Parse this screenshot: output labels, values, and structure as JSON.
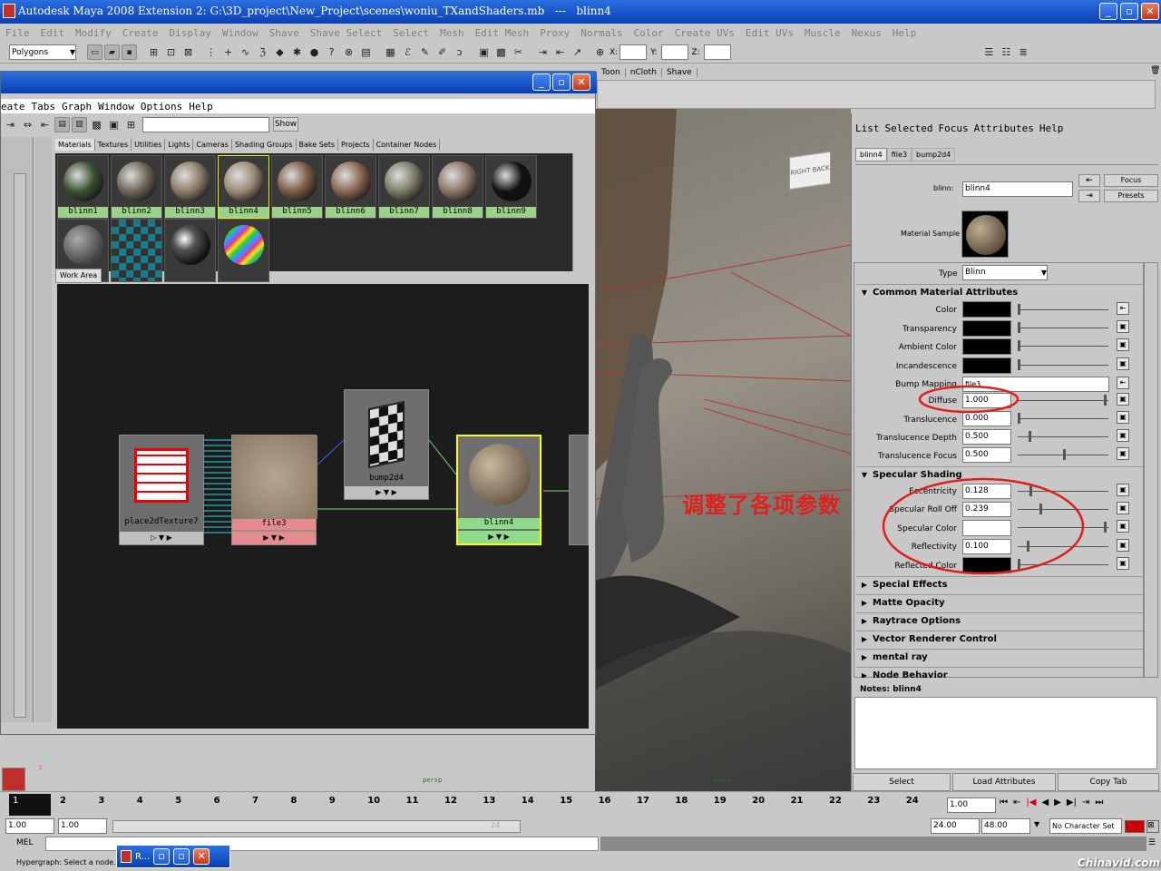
{
  "window": {
    "title": "Autodesk Maya 2008 Extension 2: G:\\3D_project\\New_Project\\scenes\\woniu_TXandShaders.mb   ---   blinn4"
  },
  "menubar": [
    "File",
    "Edit",
    "Modify",
    "Create",
    "Display",
    "Window",
    "Shave",
    "Shave Select",
    "Select",
    "Mesh",
    "Edit Mesh",
    "Proxy",
    "Normals",
    "Color",
    "Create UVs",
    "Edit UVs",
    "Muscle",
    "Nexus",
    "Help"
  ],
  "toolbar": {
    "mode": "Polygons",
    "x_label": "X:",
    "y_label": "Y:",
    "z_label": "Z:"
  },
  "shelf_tabs": [
    "Toon",
    "nCloth",
    "Shave"
  ],
  "hypershade": {
    "menu": [
      "eate",
      "Tabs",
      "Graph",
      "Window",
      "Options",
      "Help"
    ],
    "show_button": "Show",
    "tabs": [
      "Materials",
      "Textures",
      "Utilities",
      "Lights",
      "Cameras",
      "Shading Groups",
      "Bake Sets",
      "Projects",
      "Container Nodes"
    ],
    "materials": [
      {
        "name": "blinn1",
        "color": "#3a5030"
      },
      {
        "name": "blinn2",
        "color": "#6e6458"
      },
      {
        "name": "blinn3",
        "color": "#8a7a66"
      },
      {
        "name": "blinn4",
        "color": "#9a8a74"
      },
      {
        "name": "blinn5",
        "color": "#7a5a44"
      },
      {
        "name": "blinn6",
        "color": "#8a6450"
      },
      {
        "name": "blinn7",
        "color": "#7a7a64"
      },
      {
        "name": "blinn8",
        "color": "#8a7464"
      },
      {
        "name": "blinn9",
        "color": "#111111"
      }
    ],
    "work_area_tab": "Work Area",
    "nodes": {
      "place2d": "place2dTexture7",
      "file": "file3",
      "bump": "bump2d4",
      "blinn": "blinn4"
    }
  },
  "viewport": {
    "cube_right": "RIGHT",
    "cube_back": "BACK",
    "camera": "persp",
    "axis_y": "Y",
    "axis_x": "X"
  },
  "annotation": "调整了各项参数",
  "attribute_editor": {
    "menu": [
      "List",
      "Selected",
      "Focus",
      "Attributes",
      "Help"
    ],
    "tabs": [
      "blinn4",
      "file3",
      "bump2d4"
    ],
    "node_label": "blinn:",
    "node_name": "blinn4",
    "focus": "Focus",
    "presets": "Presets",
    "material_sample": "Material Sample",
    "type_label": "Type",
    "type_value": "Blinn",
    "common_section": "Common Material Attributes",
    "color": "Color",
    "transparency": "Transparency",
    "ambient": "Ambient Color",
    "incandescence": "Incandescence",
    "bump_label": "Bump Mapping",
    "bump_value": "file3",
    "diffuse_label": "Diffuse",
    "diffuse": "1.000",
    "translucence_label": "Translucence",
    "translucence": "0.000",
    "tdepth_label": "Translucence Depth",
    "tdepth": "0.500",
    "tfocus_label": "Translucence Focus",
    "tfocus": "0.500",
    "spec_section": "Specular Shading",
    "ecc_label": "Eccentricity",
    "ecc": "0.128",
    "roll_label": "Specular Roll Off",
    "roll": "0.239",
    "speccolor_label": "Specular Color",
    "refl_label": "Reflectivity",
    "refl": "0.100",
    "reflcolor_label": "Reflected Color",
    "sections": [
      "Special Effects",
      "Matte Opacity",
      "Raytrace Options",
      "Vector Renderer Control",
      "mental ray",
      "Node Behavior"
    ],
    "notes_label": "Notes:  blinn4",
    "select": "Select",
    "load": "Load Attributes",
    "copy": "Copy Tab"
  },
  "timeline": {
    "ticks": [
      "1",
      "2",
      "3",
      "4",
      "5",
      "6",
      "7",
      "8",
      "9",
      "10",
      "11",
      "12",
      "13",
      "14",
      "15",
      "16",
      "17",
      "18",
      "19",
      "20",
      "21",
      "22",
      "23",
      "24"
    ],
    "current": "1.00"
  },
  "range": {
    "start": "1.00",
    "start2": "1.00",
    "end": "24.00",
    "end2": "48.00",
    "mid": "24",
    "charset": "No Character Set"
  },
  "command": {
    "label": "MEL"
  },
  "help": {
    "text": "Hypergraph: Select a node."
  },
  "taskbar_item": "R...",
  "watermark": "Chinavid.com"
}
